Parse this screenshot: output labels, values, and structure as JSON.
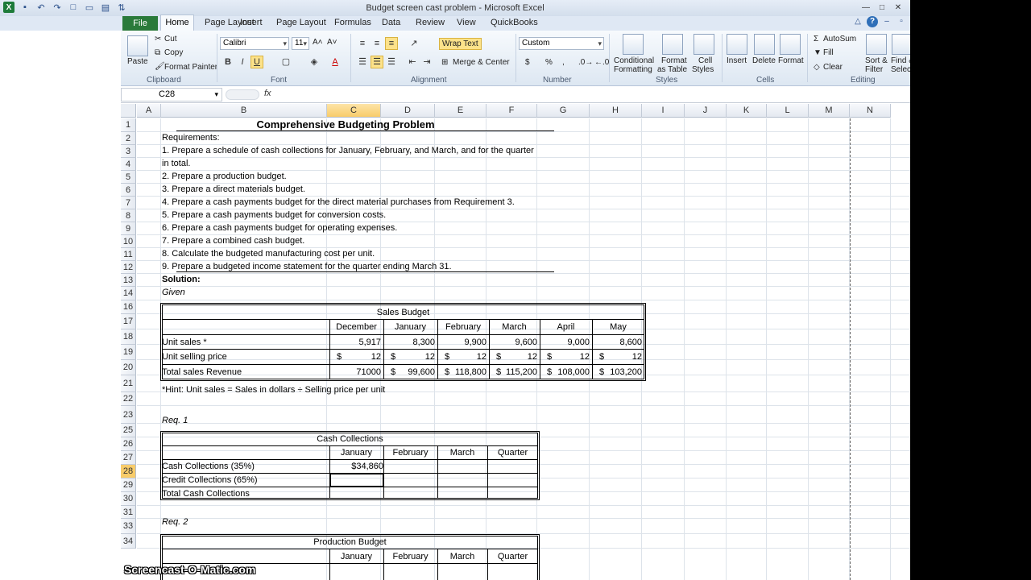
{
  "window": {
    "title": "Budget screen cast problem - Microsoft Excel"
  },
  "ribbon_tabs": [
    "File",
    "Home",
    "Insert",
    "Page Layout",
    "Formulas",
    "Data",
    "Review",
    "View",
    "QuickBooks"
  ],
  "ribbon": {
    "clipboard": {
      "label": "Clipboard",
      "paste": "Paste",
      "cut": "Cut",
      "copy": "Copy",
      "format_painter": "Format Painter"
    },
    "font": {
      "label": "Font",
      "font_name": "Calibri",
      "font_size": "11",
      "bold": "B",
      "italic": "I",
      "underline": "U"
    },
    "alignment": {
      "label": "Alignment",
      "wrap_text": "Wrap Text",
      "merge_center": "Merge & Center"
    },
    "number": {
      "label": "Number",
      "format": "Custom",
      "currency": "$",
      "percent": "%",
      "comma": ","
    },
    "styles": {
      "label": "Styles",
      "conditional": "Conditional",
      "conditional2": "Formatting",
      "format_table": "Format",
      "format_table2": "as Table",
      "cell_styles": "Cell",
      "cell_styles2": "Styles"
    },
    "cells": {
      "label": "Cells",
      "insert": "Insert",
      "delete": "Delete",
      "format": "Format"
    },
    "editing": {
      "label": "Editing",
      "autosum": "AutoSum",
      "fill": "Fill",
      "clear": "Clear",
      "sort": "Sort &",
      "sort2": "Filter",
      "find": "Find &",
      "find2": "Select"
    }
  },
  "formula_bar": {
    "name_box": "C28",
    "fx": "fx",
    "value": ""
  },
  "columns": [
    "A",
    "B",
    "C",
    "D",
    "E",
    "F",
    "G",
    "H",
    "I",
    "J",
    "K",
    "L",
    "M",
    "N"
  ],
  "rows": [
    "1",
    "2",
    "3",
    "4",
    "5",
    "6",
    "7",
    "8",
    "9",
    "10",
    "11",
    "12",
    "13",
    "14",
    "16",
    "17",
    "18",
    "19",
    "20",
    "21",
    "22",
    "23",
    "25",
    "26",
    "27",
    "28",
    "29",
    "30",
    "31",
    "33",
    "34"
  ],
  "sheet": {
    "title": "Comprehensive Budgeting Problem",
    "requirements_label": "Requirements:",
    "req_lines": [
      "1. Prepare a schedule of cash collections for January, February, and March, and for the quarter",
      "in total.",
      "2. Prepare a production budget.",
      "3. Prepare a direct materials budget.",
      "4. Prepare a cash payments budget for the direct material purchases from Requirement 3.",
      "5. Prepare a cash payments budget for conversion costs.",
      "6. Prepare a cash payments budget for operating expenses.",
      "7. Prepare a combined cash budget.",
      "8. Calculate the budgeted manufacturing cost per unit.",
      "9. Prepare a budgeted income statement for the quarter ending March 31."
    ],
    "solution": "Solution:",
    "given": "Given",
    "sales_budget": {
      "title": "Sales Budget",
      "months": [
        "December",
        "January",
        "February",
        "March",
        "April",
        "May"
      ],
      "unit_sales_label": "Unit sales *",
      "unit_sales": [
        "5,917",
        "8,300",
        "9,900",
        "9,600",
        "9,000",
        "8,600"
      ],
      "price_label": "Unit selling price",
      "price": [
        "12",
        "12",
        "12",
        "12",
        "12",
        "12"
      ],
      "revenue_label": "Total sales Revenue",
      "revenue": [
        "71000",
        "99,600",
        "118,800",
        "115,200",
        "108,000",
        "103,200"
      ],
      "currency": "$"
    },
    "hint": "*Hint: Unit sales = Sales in dollars ÷ Selling price per unit",
    "req1": "Req. 1",
    "cash_collections": {
      "title": "Cash Collections",
      "months": [
        "January",
        "February",
        "March",
        "Quarter"
      ],
      "rows": [
        "Cash Collections (35%)",
        "Credit Collections (65%)",
        "Total Cash Collections"
      ],
      "jan_cash": "$34,860"
    },
    "req2": "Req. 2",
    "production": {
      "title": "Production Budget",
      "months": [
        "January",
        "February",
        "March",
        "Quarter"
      ]
    }
  },
  "watermark": "Screencast-O-Matic.com"
}
